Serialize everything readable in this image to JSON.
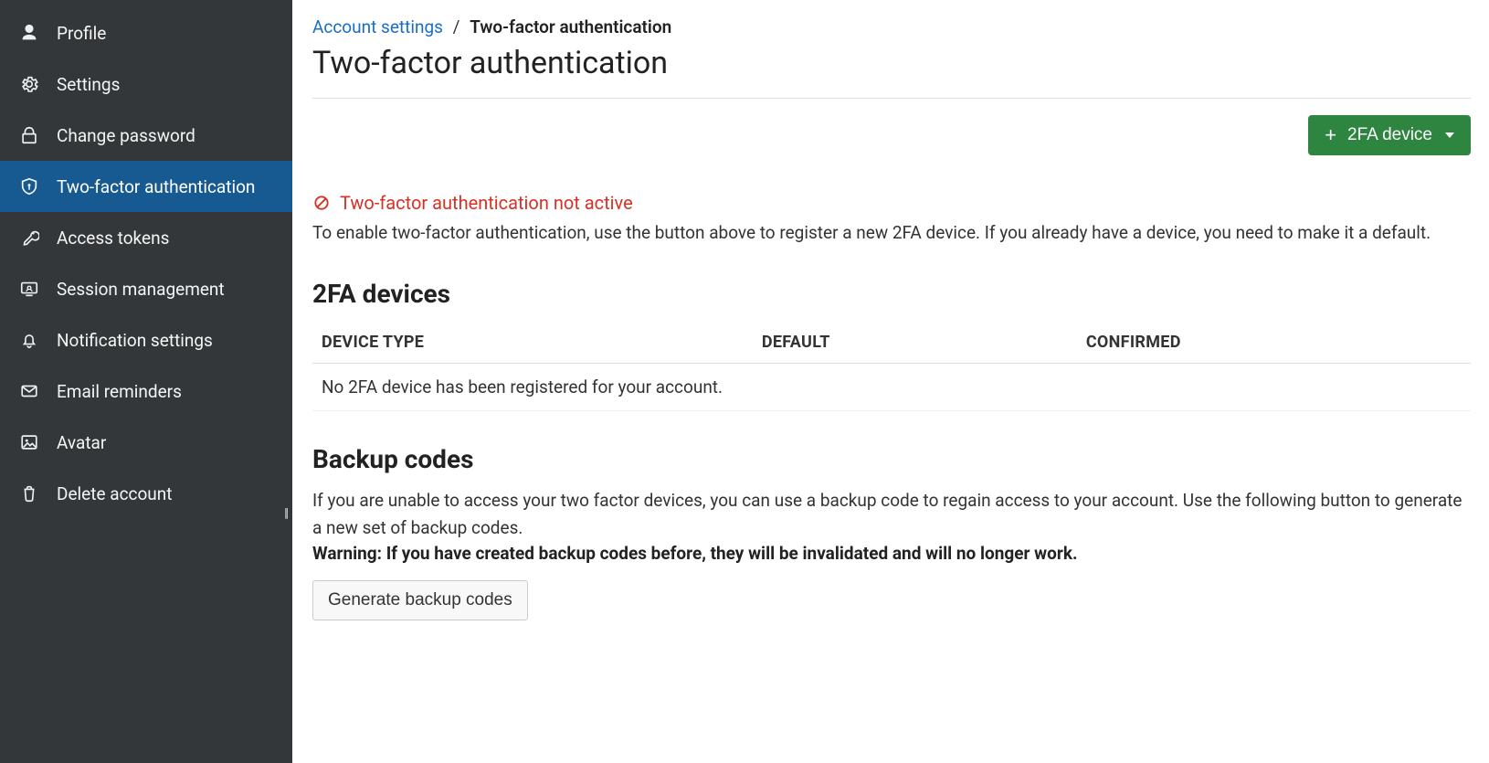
{
  "sidebar": {
    "items": [
      {
        "icon": "user-icon",
        "label": "Profile",
        "active": false
      },
      {
        "icon": "gear-icon",
        "label": "Settings",
        "active": false
      },
      {
        "icon": "lock-icon",
        "label": "Change password",
        "active": false
      },
      {
        "icon": "shield-icon",
        "label": "Two-factor authentication",
        "active": true
      },
      {
        "icon": "key-icon",
        "label": "Access tokens",
        "active": false
      },
      {
        "icon": "session-icon",
        "label": "Session management",
        "active": false
      },
      {
        "icon": "bell-icon",
        "label": "Notification settings",
        "active": false
      },
      {
        "icon": "mail-icon",
        "label": "Email reminders",
        "active": false
      },
      {
        "icon": "image-icon",
        "label": "Avatar",
        "active": false
      },
      {
        "icon": "trash-icon",
        "label": "Delete account",
        "active": false
      }
    ],
    "collapse_glyph": "||"
  },
  "breadcrumb": {
    "parent": "Account settings",
    "separator": "/",
    "current": "Two-factor authentication"
  },
  "page_title": "Two-factor authentication",
  "add_device_button_label": "2FA device",
  "alert": {
    "title": "Two-factor authentication not active",
    "description": "To enable two-factor authentication, use the button above to register a new 2FA device. If you already have a device, you need to make it a default."
  },
  "devices_section_title": "2FA devices",
  "devices_headers": {
    "device_type": "DEVICE TYPE",
    "default": "DEFAULT",
    "confirmed": "CONFIRMED"
  },
  "devices_empty_message": "No 2FA device has been registered for your account.",
  "backup": {
    "title": "Backup codes",
    "description": "If you are unable to access your two factor devices, you can use a backup code to regain access to your account. Use the following button to generate a new set of backup codes.",
    "warning_label": "Warning:",
    "warning_text": "If you have created backup codes before, they will be invalidated and will no longer work.",
    "generate_button_label": "Generate backup codes"
  }
}
